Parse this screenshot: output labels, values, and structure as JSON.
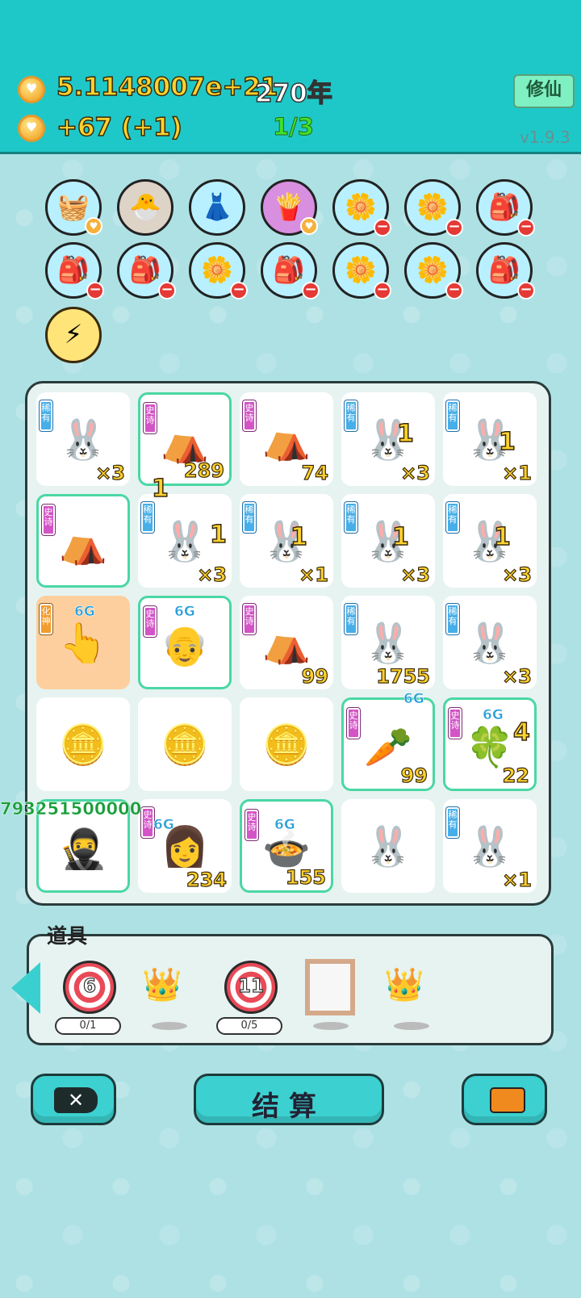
{
  "header": {
    "money": "5.1148007e+21",
    "year": "270年",
    "rate": "+67   (+1)",
    "page": "1/3",
    "xiu_button": "修仙",
    "version": "v1.9.3"
  },
  "inventory": [
    {
      "glyph": "🧺",
      "style": "",
      "badge": "heart"
    },
    {
      "glyph": "🐣",
      "style": "beige",
      "badge": ""
    },
    {
      "glyph": "👗",
      "style": "",
      "badge": ""
    },
    {
      "glyph": "🍟",
      "style": "purple",
      "badge": "heart"
    },
    {
      "glyph": "🌼",
      "style": "",
      "badge": "minus"
    },
    {
      "glyph": "🌼",
      "style": "",
      "badge": "minus"
    },
    {
      "glyph": "🎒",
      "style": "",
      "badge": "minus"
    },
    {
      "glyph": "🎒",
      "style": "",
      "badge": "minus"
    },
    {
      "glyph": "🎒",
      "style": "",
      "badge": "minus"
    },
    {
      "glyph": "🌼",
      "style": "",
      "badge": "minus"
    },
    {
      "glyph": "🎒",
      "style": "",
      "badge": "minus"
    },
    {
      "glyph": "🌼",
      "style": "",
      "badge": "minus"
    },
    {
      "glyph": "🌼",
      "style": "",
      "badge": "minus"
    },
    {
      "glyph": "🎒",
      "style": "",
      "badge": "minus"
    },
    {
      "glyph": "⚡",
      "style": "yellow",
      "badge": ""
    }
  ],
  "board": {
    "cells": [
      {
        "tag": "稀有",
        "tagColor": "blue",
        "glyph": "🐰",
        "count": "×3",
        "style": ""
      },
      {
        "tag": "史诗",
        "tagColor": "pink",
        "glyph": "⛺",
        "count": "289",
        "style": "epic"
      },
      {
        "tag": "史诗",
        "tagColor": "pink",
        "glyph": "⛺",
        "count": "74",
        "style": ""
      },
      {
        "tag": "稀有",
        "tagColor": "blue",
        "glyph": "🐰",
        "count": "×3",
        "style": ""
      },
      {
        "tag": "稀有",
        "tagColor": "blue",
        "glyph": "🐰",
        "count": "×1",
        "style": ""
      },
      {
        "tag": "史诗",
        "tagColor": "pink",
        "glyph": "⛺",
        "count": "",
        "style": "epic"
      },
      {
        "tag": "稀有",
        "tagColor": "blue",
        "glyph": "🐰",
        "count": "×3",
        "style": ""
      },
      {
        "tag": "稀有",
        "tagColor": "blue",
        "glyph": "🐰",
        "count": "×1",
        "style": ""
      },
      {
        "tag": "稀有",
        "tagColor": "blue",
        "glyph": "🐰",
        "count": "×3",
        "style": ""
      },
      {
        "tag": "稀有",
        "tagColor": "blue",
        "glyph": "🐰",
        "count": "×3",
        "style": ""
      },
      {
        "tag": "化神",
        "tagColor": "orange",
        "glyph": "👆",
        "count": "",
        "style": "orange"
      },
      {
        "tag": "史诗",
        "tagColor": "pink",
        "glyph": "👴",
        "count": "",
        "style": "epic"
      },
      {
        "tag": "史诗",
        "tagColor": "pink",
        "glyph": "⛺",
        "count": "99",
        "style": ""
      },
      {
        "tag": "稀有",
        "tagColor": "blue",
        "glyph": "🐰",
        "count": "1755",
        "style": ""
      },
      {
        "tag": "稀有",
        "tagColor": "blue",
        "glyph": "🐰",
        "count": "×3",
        "style": ""
      },
      {
        "tag": "",
        "tagColor": "",
        "glyph": "🪙",
        "count": "",
        "style": ""
      },
      {
        "tag": "",
        "tagColor": "",
        "glyph": "🪙",
        "count": "",
        "style": ""
      },
      {
        "tag": "",
        "tagColor": "",
        "glyph": "🪙",
        "count": "",
        "style": ""
      },
      {
        "tag": "史诗",
        "tagColor": "pink",
        "glyph": "🥕",
        "count": "99",
        "style": "epic"
      },
      {
        "tag": "史诗",
        "tagColor": "pink",
        "glyph": "🍀",
        "count": "22",
        "style": "epic"
      },
      {
        "tag": "",
        "tagColor": "",
        "glyph": "🥷",
        "count": "",
        "style": "epic"
      },
      {
        "tag": "史诗",
        "tagColor": "pink",
        "glyph": "👩",
        "count": "234",
        "style": ""
      },
      {
        "tag": "史诗",
        "tagColor": "pink",
        "glyph": "🍲",
        "count": "155",
        "style": "epic"
      },
      {
        "tag": "",
        "tagColor": "",
        "glyph": "🐰",
        "count": "",
        "style": ""
      },
      {
        "tag": "稀有",
        "tagColor": "blue",
        "glyph": "🐰",
        "count": "×1",
        "style": ""
      }
    ],
    "floats": [
      "1",
      "1",
      "1",
      "1",
      "1",
      "1",
      "1",
      "4"
    ],
    "gen_labels": [
      "6G",
      "6G",
      "6G",
      "6G",
      "6G",
      "6G"
    ],
    "floating_id": "793251500000"
  },
  "tools": {
    "label": "道具",
    "items": [
      {
        "type": "target",
        "num": "6",
        "progress": "0/1"
      },
      {
        "type": "crown"
      },
      {
        "type": "target",
        "num": "11",
        "progress": "0/5"
      },
      {
        "type": "frame"
      },
      {
        "type": "crown"
      }
    ]
  },
  "buttons": {
    "close_icon": "close-icon",
    "settle": "结算",
    "bag_icon": "briefcase-icon"
  }
}
